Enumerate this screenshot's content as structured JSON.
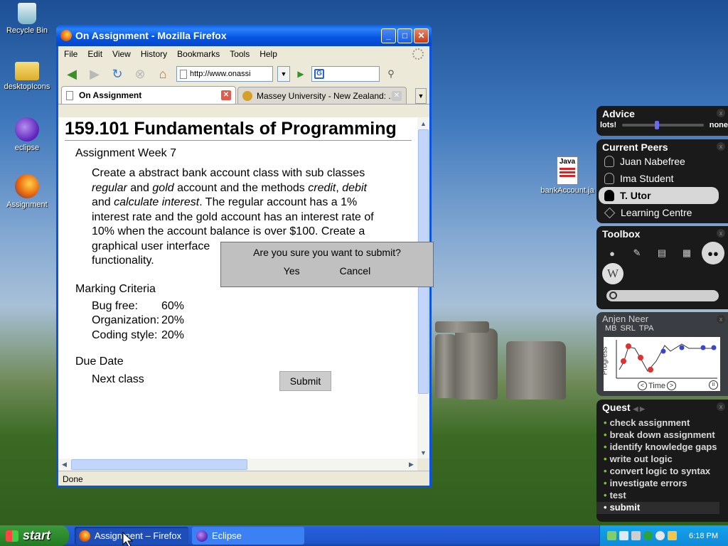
{
  "desktop": {
    "icons": [
      {
        "label": "Recycle Bin",
        "icon": "recycle-bin-icon"
      },
      {
        "label": "desktopIcons",
        "icon": "folder-icon"
      },
      {
        "label": "eclipse",
        "icon": "eclipse-icon"
      },
      {
        "label": "Assignment",
        "icon": "firefox-icon"
      },
      {
        "label": "bankAccount.ja",
        "icon": "java-file-icon",
        "badge": "Java"
      }
    ]
  },
  "browser": {
    "title": "On Assignment - Mozilla Firefox",
    "menu": [
      "File",
      "Edit",
      "View",
      "History",
      "Bookmarks",
      "Tools",
      "Help"
    ],
    "url": "http://www.onassi",
    "tabs": [
      {
        "label": "On Assignment",
        "active": true
      },
      {
        "label": "Massey University - New Zealand: ...",
        "active": false
      }
    ],
    "status": "Done"
  },
  "page": {
    "heading": "159.101 Fundamentals of Programming",
    "section1": "Assignment Week 7",
    "p1": "Create a abstract bank account class with sub classes",
    "p2_i1": "regular",
    "p2_t1": " and ",
    "p2_i2": "gold",
    "p2_t2": " account and the methods ",
    "p2_i3": "credit",
    "p2_t3": ", ",
    "p2_i4": "debit",
    "p3_t1": "and ",
    "p3_i1": "calculate interest",
    "p3_t2": ". The regular account has a 1%",
    "p4": "interest rate and the gold account has an interest rate of",
    "p5": "10% when the account balance is over $100. Create a",
    "p6": "graphical user interface",
    "p7": "functionality.",
    "section2": "Marking Criteria",
    "criteria": [
      {
        "label": "Bug free:",
        "value": "60%"
      },
      {
        "label": "Organization:",
        "value": "20%"
      },
      {
        "label": "Coding style:",
        "value": "20%"
      }
    ],
    "section3": "Due Date",
    "due": "Next class",
    "submit": "Submit"
  },
  "dialog": {
    "question": "Are you sure you want to submit?",
    "yes": "Yes",
    "cancel": "Cancel"
  },
  "advice": {
    "title": "Advice",
    "left": "lots!",
    "right": "none",
    "level": 0.4
  },
  "peers": {
    "title": "Current Peers",
    "items": [
      "Juan Nabefree",
      "Ima Student",
      "T. Utor",
      "Learning Centre"
    ],
    "selected": 2
  },
  "toolbox": {
    "title": "Toolbox",
    "tools": [
      "firefox-icon",
      "pen-icon",
      "flashcard-icon",
      "notes-icon",
      "peers-icon",
      "wikipedia-icon"
    ],
    "wiki_letter": "W"
  },
  "progress": {
    "title": "Anjen Neer",
    "tabs": [
      "MB",
      "SRL",
      "TPA"
    ],
    "ylabel": "Progress",
    "xlabel": "Time",
    "prev": "<",
    "next": ">",
    "pause": "II"
  },
  "quest": {
    "title": "Quest",
    "items": [
      "check assignment",
      "break down assignment",
      "identify knowledge gaps",
      "write out logic",
      "convert logic to syntax",
      "investigate errors",
      "test",
      "submit"
    ],
    "current": 7
  },
  "taskbar": {
    "start": "start",
    "tasks": [
      {
        "label": "Assignment – Firefox"
      },
      {
        "label": "Eclipse"
      }
    ],
    "time": "6:18 PM"
  },
  "colors": {
    "xp_blue": "#0a54e3",
    "panel_bg": "#1a1a1a",
    "quest_bullet": "#7fbf3f"
  }
}
